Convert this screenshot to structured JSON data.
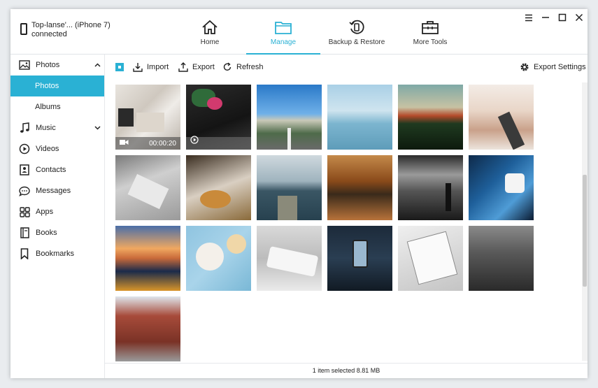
{
  "device": {
    "name": "Top-lanse'... (iPhone 7)",
    "status": "connected"
  },
  "nav": [
    {
      "label": "Home",
      "icon": "home-icon"
    },
    {
      "label": "Manage",
      "icon": "folder-icon",
      "active": true
    },
    {
      "label": "Backup & Restore",
      "icon": "backup-restore-icon"
    },
    {
      "label": "More Tools",
      "icon": "toolbox-icon"
    }
  ],
  "sidebar": {
    "photos": "Photos",
    "photos_sub": "Photos",
    "albums": "Albums",
    "music": "Music",
    "videos": "Videos",
    "contacts": "Contacts",
    "messages": "Messages",
    "apps": "Apps",
    "books": "Books",
    "bookmarks": "Bookmarks"
  },
  "toolbar": {
    "import": "Import",
    "export": "Export",
    "refresh": "Refresh",
    "export_settings": "Export Settings"
  },
  "video_duration": "00:00:20",
  "status_text": "1 item selected 8.81 MB",
  "colors": {
    "accent": "#2ab1d4"
  }
}
